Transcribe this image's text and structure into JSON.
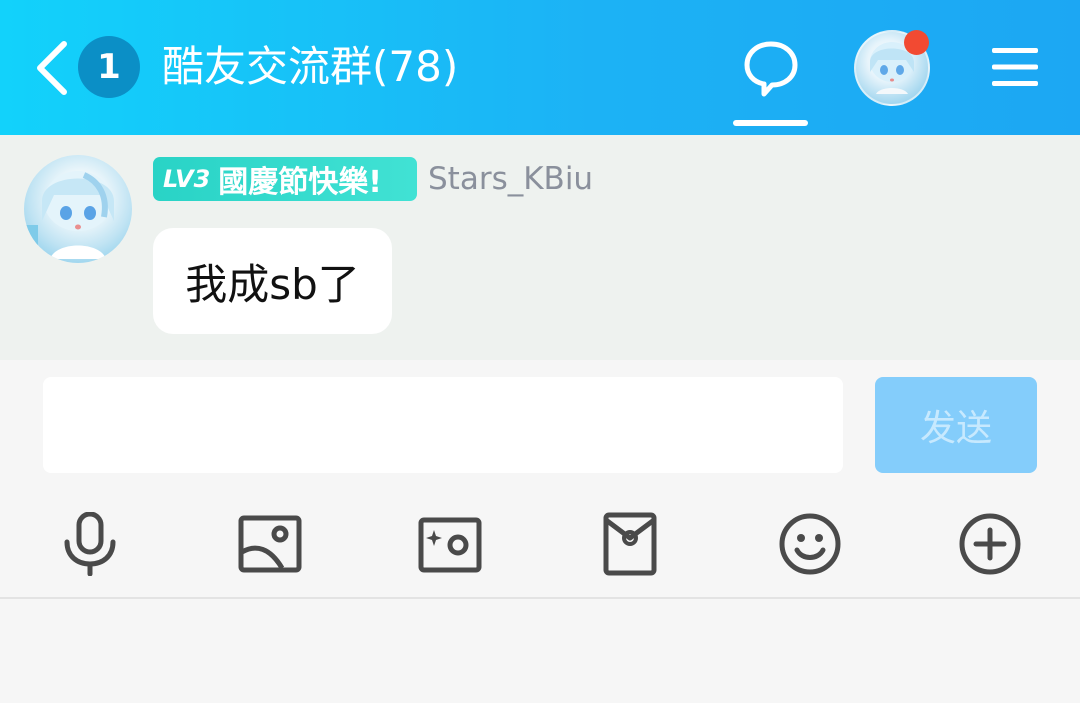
{
  "header": {
    "unread_count": "1",
    "title": "酷友交流群(78)",
    "icons": {
      "back": "chevron-left-icon",
      "chat": "chat-bubble-icon",
      "menu": "menu-icon"
    },
    "colors": {
      "gradient_start": "#12d2fb",
      "gradient_end": "#1ca7f3",
      "badge": "#0b8fc6",
      "notify_dot": "#f24a32"
    }
  },
  "messages": [
    {
      "level": "LV3",
      "tag": "國慶節快樂!",
      "sender": "Stars_KBiu",
      "text": "我成sb了"
    }
  ],
  "composer": {
    "input_value": "",
    "send_label": "发送",
    "send_color": "#84cdfb"
  },
  "toolbar": [
    {
      "name": "voice",
      "icon": "microphone-icon"
    },
    {
      "name": "image",
      "icon": "image-icon"
    },
    {
      "name": "camera",
      "icon": "camera-icon"
    },
    {
      "name": "red-packet",
      "icon": "red-envelope-icon"
    },
    {
      "name": "emoji",
      "icon": "smiley-icon"
    },
    {
      "name": "more",
      "icon": "plus-circle-icon"
    }
  ]
}
